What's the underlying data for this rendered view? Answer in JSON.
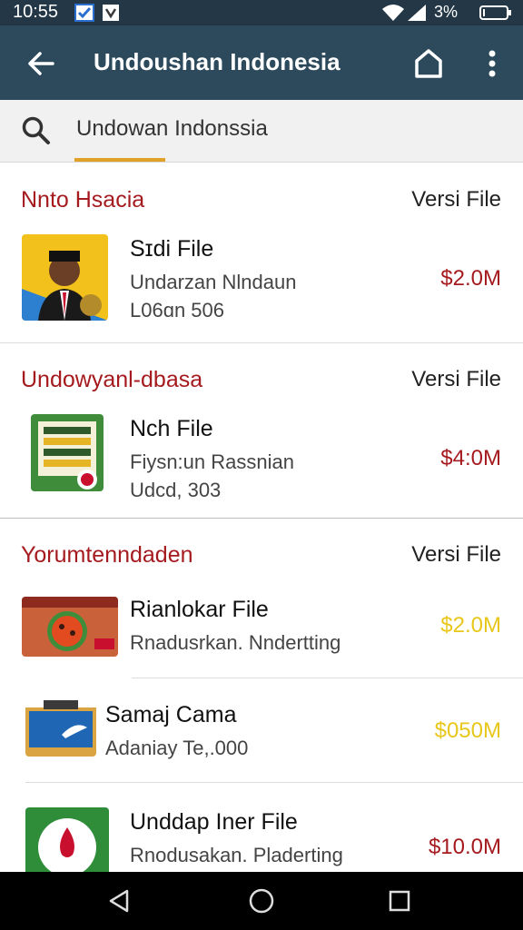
{
  "status": {
    "time": "10:55",
    "battery_pct": "3%"
  },
  "appbar": {
    "title": "Undoushan Indonesia"
  },
  "search": {
    "query": "Undowan Indonssia"
  },
  "colors": {
    "appbar": "#2c4a5c",
    "section_title": "#a51a1e",
    "accent": "#e0a126",
    "price_red": "#a51a1e",
    "price_yellow": "#e8c71a"
  },
  "sections": [
    {
      "title": "Nnto Hsacia",
      "right": "Versi File",
      "items": [
        {
          "title": "Sɪdi File",
          "sub1": "Undarzan Nlndaun",
          "sub2": "L06ɑn 506",
          "price": "$2.0M",
          "icon": "portrait-thumb-icon"
        }
      ]
    },
    {
      "title": "Undowyanl-dbasa",
      "right": "Versi File",
      "items": [
        {
          "title": "Nch File",
          "sub1": "Fiysn:un Rassnian",
          "sub2": "Udcd, 303",
          "price": "$4:0M",
          "icon": "board-game-thumb-icon"
        }
      ]
    },
    {
      "title": "Yorumtenndaden",
      "right": "Versi File",
      "items": [
        {
          "title": "Rianlokar File",
          "sub1": "Rnadusrkan. Nndertting",
          "price": "$2.0M",
          "icon": "pizza-thumb-icon"
        },
        {
          "title": "Samaj Cama",
          "sub1": "Adaniay Te,.000",
          "price": "$050M",
          "icon": "box-thumb-icon"
        },
        {
          "title": "Unddap Iner File",
          "sub1": "Rnodusakan. Pladerting",
          "price": "$10.0M",
          "icon": "drop-thumb-icon"
        }
      ]
    }
  ]
}
